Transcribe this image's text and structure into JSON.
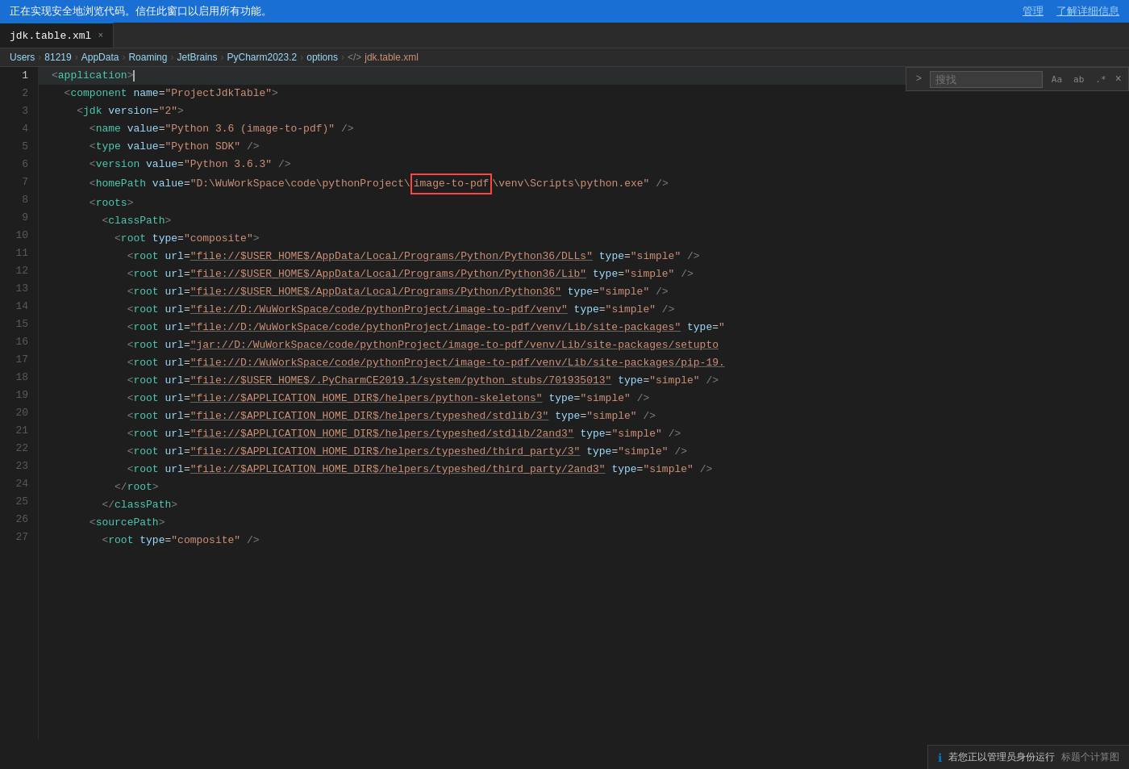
{
  "security_bar": {
    "message": "正在实现安全地浏览代码。信任此窗口以启用所有功能。",
    "manage_label": "管理",
    "learn_label": "了解详细信息"
  },
  "tab": {
    "filename": "jdk.table.xml",
    "close_icon": "×"
  },
  "breadcrumb": {
    "parts": [
      "Users",
      "81219",
      "AppData",
      "Roaming",
      "JetBrains",
      "PyCharm2023.2",
      "options",
      "</>",
      "jdk.table.xml"
    ]
  },
  "search": {
    "placeholder": "搜找",
    "toggle_label": ">",
    "aa_label": "Aa",
    "ab_label": "ab",
    "star_label": ".*",
    "close_label": "×"
  },
  "lines": [
    {
      "num": 1,
      "content": "<application>"
    },
    {
      "num": 2,
      "content": "  <component name=\"ProjectJdkTable\">"
    },
    {
      "num": 3,
      "content": "    <jdk version=\"2\">"
    },
    {
      "num": 4,
      "content": "      <name value=\"Python 3.6 (image-to-pdf)\" />"
    },
    {
      "num": 5,
      "content": "      <type value=\"Python SDK\" />"
    },
    {
      "num": 6,
      "content": "      <version value=\"Python 3.6.3\" />"
    },
    {
      "num": 7,
      "content": "      <homePath value=\"D:\\WuWorkSpace\\code\\pythonProject\\image-to-pdf\\venv\\Scripts\\python.exe\" />"
    },
    {
      "num": 8,
      "content": "      <roots>"
    },
    {
      "num": 9,
      "content": "        <classPath>"
    },
    {
      "num": 10,
      "content": "          <root type=\"composite\">"
    },
    {
      "num": 11,
      "content": "            <root url=\"file://$USER_HOME$/AppData/Local/Programs/Python/Python36/DLLs\" type=\"simple\" />"
    },
    {
      "num": 12,
      "content": "            <root url=\"file://$USER_HOME$/AppData/Local/Programs/Python/Python36/Lib\" type=\"simple\" />"
    },
    {
      "num": 13,
      "content": "            <root url=\"file://$USER_HOME$/AppData/Local/Programs/Python/Python36\" type=\"simple\" />"
    },
    {
      "num": 14,
      "content": "            <root url=\"file://D:/WuWorkSpace/code/pythonProject/image-to-pdf/venv\" type=\"simple\" />"
    },
    {
      "num": 15,
      "content": "            <root url=\"file://D:/WuWorkSpace/code/pythonProject/image-to-pdf/venv/Lib/site-packages\" type="
    },
    {
      "num": 16,
      "content": "            <root url=\"jar://D:/WuWorkSpace/code/pythonProject/image-to-pdf/venv/Lib/site-packages/setupto"
    },
    {
      "num": 17,
      "content": "            <root url=\"file://D:/WuWorkSpace/code/pythonProject/image-to-pdf/venv/Lib/site-packages/pip-19."
    },
    {
      "num": 18,
      "content": "            <root url=\"file://$USER_HOME$/.PyCharmCE2019.1/system/python_stubs/701935013\" type=\"simple\" />"
    },
    {
      "num": 19,
      "content": "            <root url=\"file://$APPLICATION_HOME_DIR$/helpers/python-skeletons\" type=\"simple\" />"
    },
    {
      "num": 20,
      "content": "            <root url=\"file://$APPLICATION_HOME_DIR$/helpers/typeshed/stdlib/3\" type=\"simple\" />"
    },
    {
      "num": 21,
      "content": "            <root url=\"file://$APPLICATION_HOME_DIR$/helpers/typeshed/stdlib/2and3\" type=\"simple\" />"
    },
    {
      "num": 22,
      "content": "            <root url=\"file://$APPLICATION_HOME_DIR$/helpers/typeshed/third_party/3\" type=\"simple\" />"
    },
    {
      "num": 23,
      "content": "            <root url=\"file://$APPLICATION_HOME_DIR$/helpers/typeshed/third_party/2and3\" type=\"simple\" />"
    },
    {
      "num": 24,
      "content": "          </root>"
    },
    {
      "num": 25,
      "content": "        </classPath>"
    },
    {
      "num": 26,
      "content": "      <sourcePath>"
    },
    {
      "num": 27,
      "content": "        <root type=\"composite\" />"
    }
  ],
  "notification": {
    "icon": "ℹ",
    "text": "若您正以管理员身份运行",
    "subtext": "标题个计算图"
  },
  "colors": {
    "accent": "#007acc",
    "highlight_border": "#ff4444",
    "bg_dark": "#1e1e1e",
    "bg_tab": "#2b2b2b"
  }
}
